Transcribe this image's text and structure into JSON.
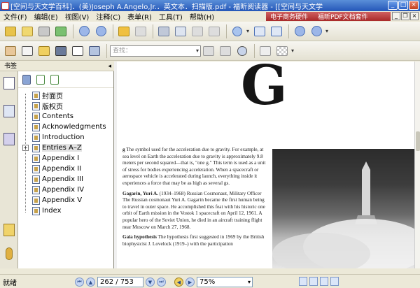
{
  "window": {
    "title": "[空间与天文学百科]．(美)Joseph A.Angelo,Jr.．英文本．扫描版.pdf - 福昕阅读器 - [[空间与天文学"
  },
  "menu": {
    "items": [
      "文件(F)",
      "编辑(E)",
      "视图(V)",
      "注释(C)",
      "表单(R)",
      "工具(T)",
      "帮助(H)"
    ]
  },
  "ad": {
    "text1": "电子商务硬件",
    "text2": "福昕PDF文档套件"
  },
  "toolbar2": {
    "find_placeholder": "查找："
  },
  "panel": {
    "title": "书签",
    "pin": "◂"
  },
  "bookmarks": [
    {
      "label": "封面页",
      "selected": false,
      "expandable": false
    },
    {
      "label": "版权页",
      "selected": false,
      "expandable": false
    },
    {
      "label": "Contents",
      "selected": false,
      "expandable": false
    },
    {
      "label": "Acknowledgments",
      "selected": false,
      "expandable": false
    },
    {
      "label": "Introduction",
      "selected": false,
      "expandable": false
    },
    {
      "label": "Entries A–Z",
      "selected": true,
      "expandable": true
    },
    {
      "label": "Appendix I",
      "selected": false,
      "expandable": false
    },
    {
      "label": "Appendix II",
      "selected": false,
      "expandable": false
    },
    {
      "label": "Appendix III",
      "selected": false,
      "expandable": false
    },
    {
      "label": "Appendix IV",
      "selected": false,
      "expandable": false
    },
    {
      "label": "Appendix V",
      "selected": false,
      "expandable": false
    },
    {
      "label": "Index",
      "selected": false,
      "expandable": false
    }
  ],
  "document": {
    "heading": "G",
    "entries": [
      {
        "term": "g",
        "body": "The symbol used for the acceleration due to gravity. For example, at sea level on Earth the acceleration due to gravity is approximately 9.8 meters per second squared—that is, \"one g.\" This term is used as a unit of stress for bodies experiencing acceleration. When a spacecraft or aerospace vehicle is accelerated during launch, everything inside it experiences a force that may be as high as several gs."
      },
      {
        "term": "Gagarin, Yuri A.",
        "body": "(1934–1968) Russian Cosmonaut, Military Officer The Russian cosmonaut Yuri A. Gagarin became the first human being to travel in outer space. He accomplished this feat with his historic one orbit of Earth mission in the Vostok 1 spacecraft on April 12, 1961. A popular hero of the Soviet Union, he died in an aircraft training flight near Moscow on March 27, 1968."
      },
      {
        "term": "Gaia hypothesis",
        "body": "The hypothesis first suggested in 1969 by the British biophysicist J. Lovelock (1919–) with the participation"
      }
    ]
  },
  "status": {
    "text": "就绪",
    "page": "262 / 753",
    "zoom": "75%"
  }
}
